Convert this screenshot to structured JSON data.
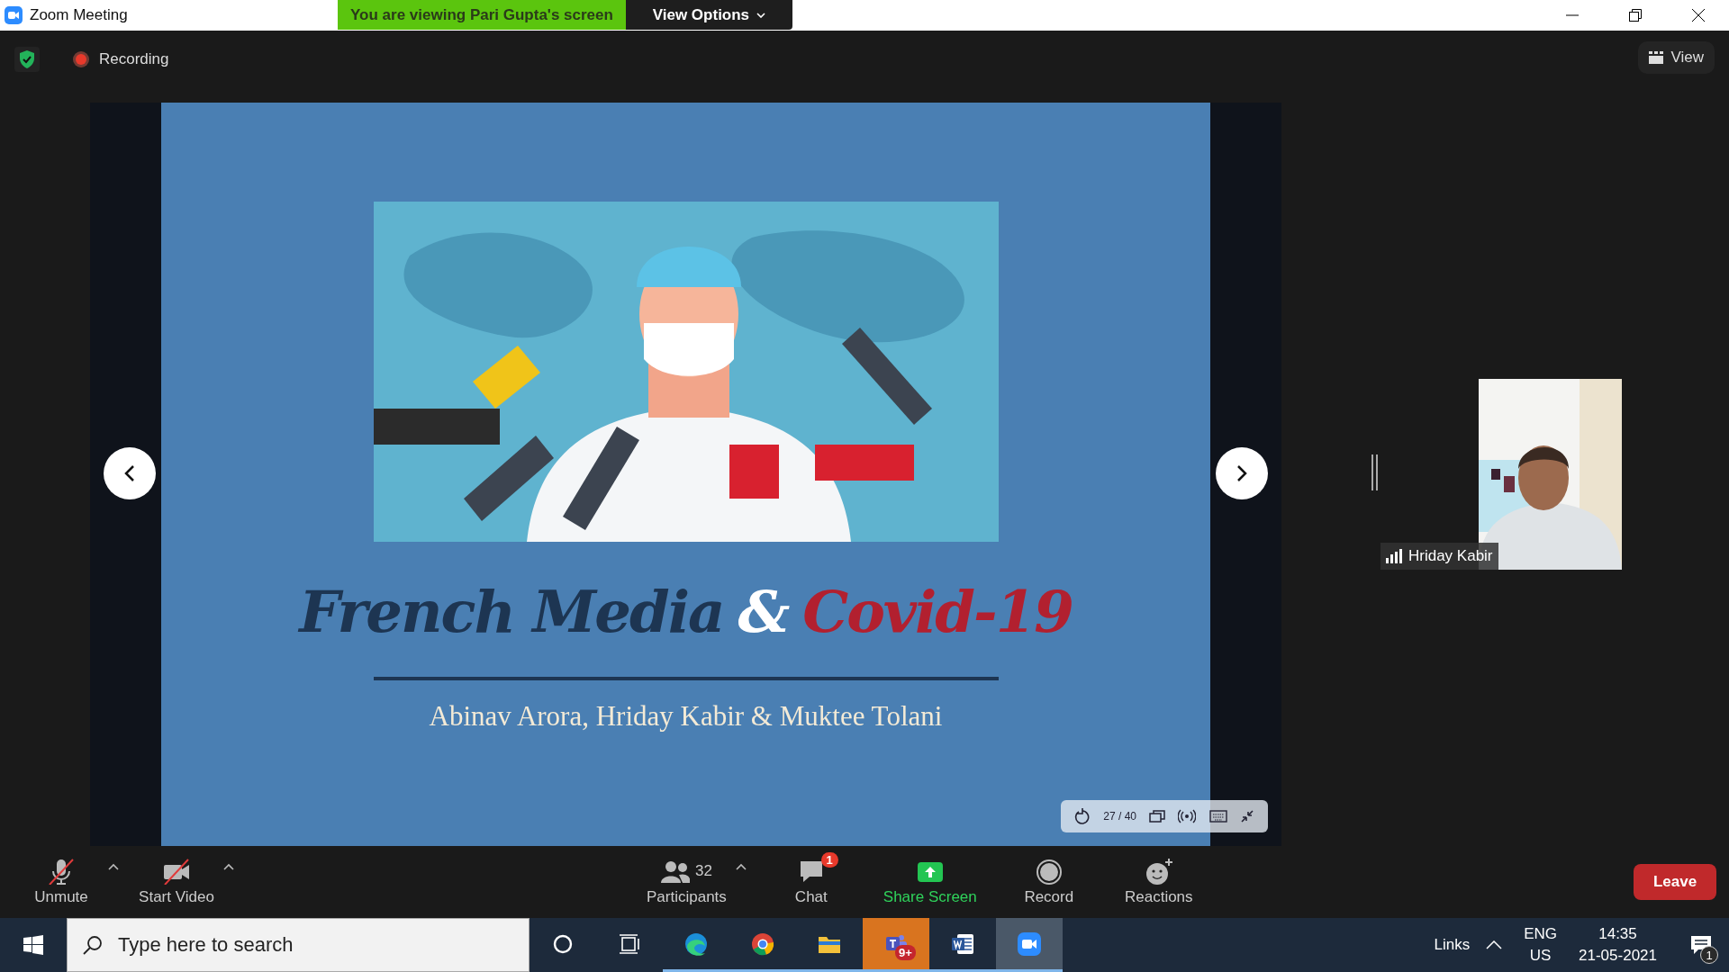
{
  "window": {
    "title": "Zoom Meeting"
  },
  "share_banner": {
    "text": "You are viewing Pari Gupta's screen",
    "view_options": "View Options"
  },
  "top_bar": {
    "recording": "Recording",
    "view": "View"
  },
  "slide": {
    "title_parts": [
      {
        "text": "French Media",
        "color": "#1d3552"
      },
      {
        "text": "&",
        "color": "#ffffff"
      },
      {
        "text": "Covid-19",
        "color": "#b2202f"
      }
    ],
    "authors": "Abinav Arora, Hriday Kabir & Muktee Tolani"
  },
  "slide_controls": {
    "page": "27 / 40"
  },
  "participant": {
    "name": "Hriday Kabir"
  },
  "toolbar": [
    {
      "kind": "mic",
      "label": "Unmute",
      "off": true,
      "caret": true
    },
    {
      "kind": "video",
      "label": "Start Video",
      "off": true,
      "caret": true
    },
    {
      "kind": "participants",
      "label": "Participants",
      "count": "32",
      "off": false,
      "caret": true
    },
    {
      "kind": "chat",
      "label": "Chat",
      "badge": "1",
      "off": false,
      "caret": false
    },
    {
      "kind": "share",
      "label": "Share Screen",
      "off": false,
      "caret": false
    },
    {
      "kind": "record",
      "label": "Record",
      "off": false,
      "caret": false
    },
    {
      "kind": "reactions",
      "label": "Reactions",
      "off": false,
      "caret": false
    }
  ],
  "leave": "Leave",
  "taskbar": {
    "search": {
      "placeholder": "Type here to search"
    },
    "apps": [
      {
        "kind": "cortana",
        "running": false,
        "flashing": false,
        "active": false
      },
      {
        "kind": "taskview",
        "running": false,
        "flashing": false,
        "active": false
      },
      {
        "kind": "edge",
        "running": true,
        "flashing": false,
        "active": false
      },
      {
        "kind": "chrome",
        "running": true,
        "flashing": false,
        "active": false
      },
      {
        "kind": "files",
        "running": true,
        "flashing": false,
        "active": false
      },
      {
        "kind": "teams",
        "running": true,
        "flashing": true,
        "active": false,
        "badge": "9+"
      },
      {
        "kind": "word",
        "running": true,
        "flashing": false,
        "active": false
      },
      {
        "kind": "zoom",
        "running": true,
        "flashing": false,
        "active": true
      }
    ],
    "tray": {
      "links": "Links",
      "language": "ENG",
      "region": "US",
      "time": "14:35",
      "date": "21-05-2021",
      "notifications": "1"
    }
  }
}
